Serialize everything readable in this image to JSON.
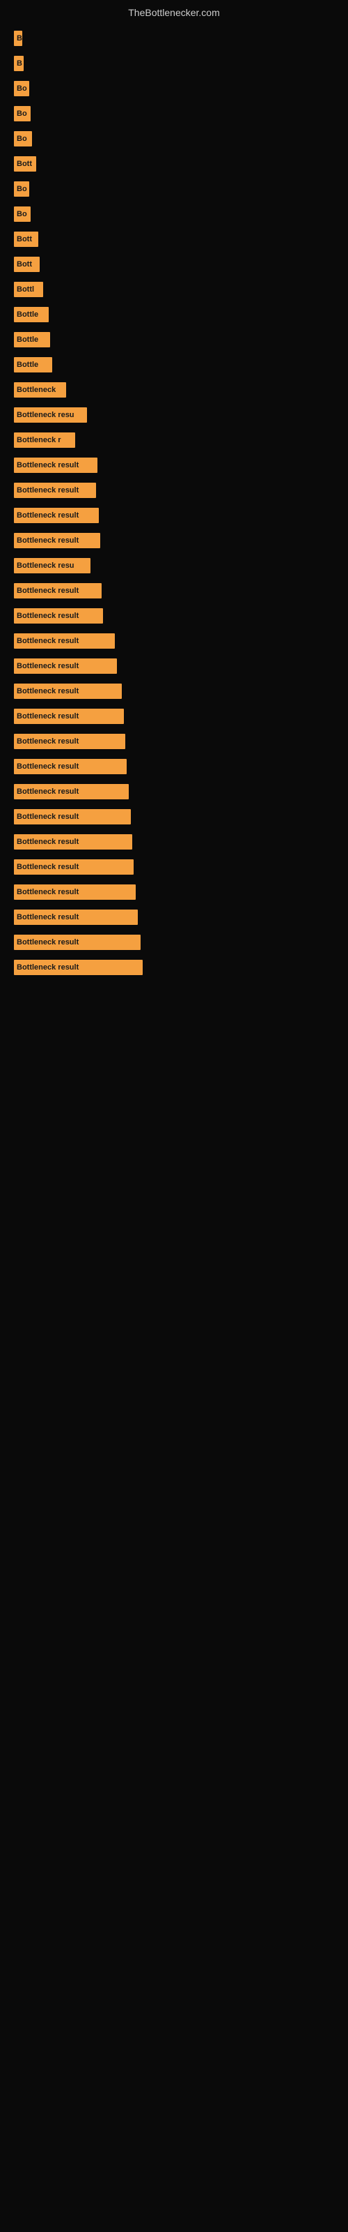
{
  "header": {
    "title": "TheBottlenecker.com"
  },
  "bars": [
    {
      "label": "B",
      "width": 12
    },
    {
      "label": "B",
      "width": 14
    },
    {
      "label": "Bo",
      "width": 22
    },
    {
      "label": "Bo",
      "width": 24
    },
    {
      "label": "Bo",
      "width": 26
    },
    {
      "label": "Bott",
      "width": 32
    },
    {
      "label": "Bo",
      "width": 22
    },
    {
      "label": "Bo",
      "width": 24
    },
    {
      "label": "Bott",
      "width": 35
    },
    {
      "label": "Bott",
      "width": 37
    },
    {
      "label": "Bottl",
      "width": 42
    },
    {
      "label": "Bottle",
      "width": 50
    },
    {
      "label": "Bottle",
      "width": 52
    },
    {
      "label": "Bottle",
      "width": 55
    },
    {
      "label": "Bottleneck",
      "width": 75
    },
    {
      "label": "Bottleneck resu",
      "width": 105
    },
    {
      "label": "Bottleneck r",
      "width": 88
    },
    {
      "label": "Bottleneck result",
      "width": 120
    },
    {
      "label": "Bottleneck result",
      "width": 118
    },
    {
      "label": "Bottleneck result",
      "width": 122
    },
    {
      "label": "Bottleneck result",
      "width": 124
    },
    {
      "label": "Bottleneck resu",
      "width": 110
    },
    {
      "label": "Bottleneck result",
      "width": 126
    },
    {
      "label": "Bottleneck result",
      "width": 128
    },
    {
      "label": "Bottleneck result",
      "width": 145
    },
    {
      "label": "Bottleneck result",
      "width": 148
    },
    {
      "label": "Bottleneck result",
      "width": 155
    },
    {
      "label": "Bottleneck result",
      "width": 158
    },
    {
      "label": "Bottleneck result",
      "width": 160
    },
    {
      "label": "Bottleneck result",
      "width": 162
    },
    {
      "label": "Bottleneck result",
      "width": 165
    },
    {
      "label": "Bottleneck result",
      "width": 168
    },
    {
      "label": "Bottleneck result",
      "width": 170
    },
    {
      "label": "Bottleneck result",
      "width": 172
    },
    {
      "label": "Bottleneck result",
      "width": 175
    },
    {
      "label": "Bottleneck result",
      "width": 178
    },
    {
      "label": "Bottleneck result",
      "width": 182
    },
    {
      "label": "Bottleneck result",
      "width": 185
    }
  ]
}
